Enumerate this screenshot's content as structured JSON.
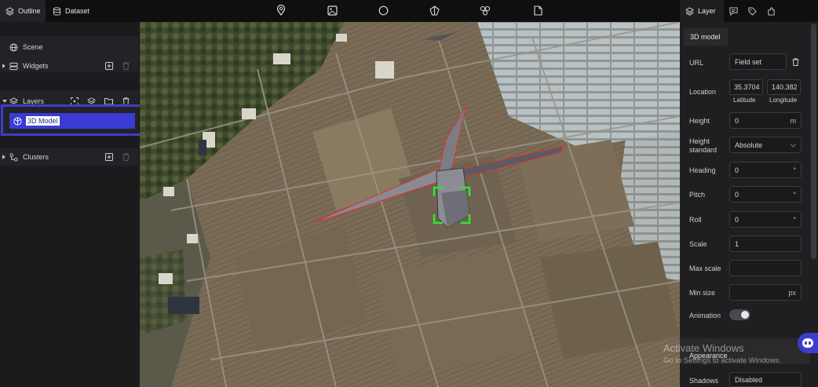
{
  "top_tabs": {
    "outline": "Outline",
    "dataset": "Dataset"
  },
  "toolbar_icons": [
    "map-pin-icon",
    "image-icon",
    "circle-icon",
    "polygon-icon",
    "cluster-icon",
    "document-icon"
  ],
  "outline": {
    "scene": "Scene",
    "widgets": "Widgets",
    "layers": "Layers",
    "selected_layer": "3D Model",
    "clusters": "Clusters"
  },
  "panel": {
    "tab_label": "Layer",
    "subtab": "3D model",
    "url_label": "URL",
    "url_value": "Field set",
    "location_label": "Location",
    "latitude_value": "35.3704",
    "longitude_value": "140.382",
    "latitude_label": "Latitude",
    "longitude_label": "Longitude",
    "height_label": "Height",
    "height_value": "0",
    "height_unit": "m",
    "height_standard_label_1": "Height",
    "height_standard_label_2": "standard",
    "height_standard_value": "Absolute",
    "heading_label": "Heading",
    "heading_value": "0",
    "pitch_label": "Pitch",
    "pitch_value": "0",
    "roll_label": "Roll",
    "roll_value": "0",
    "degree_unit": "°",
    "scale_label": "Scale",
    "scale_value": "1",
    "max_scale_label": "Max scale",
    "min_size_label": "Min size",
    "min_size_unit": "px",
    "animation_label": "Animation",
    "appearance_label": "Appearance",
    "shadows_label": "Shadows",
    "shadows_value": "Disabled"
  },
  "watermark": {
    "line1": "Activate Windows",
    "line2": "Go to Settings to activate Windows."
  },
  "colors": {
    "accent": "#3d3dcc",
    "selection": "#3a3ad4",
    "model_outline": "#e03030",
    "gizmo": "#2ee82e"
  }
}
